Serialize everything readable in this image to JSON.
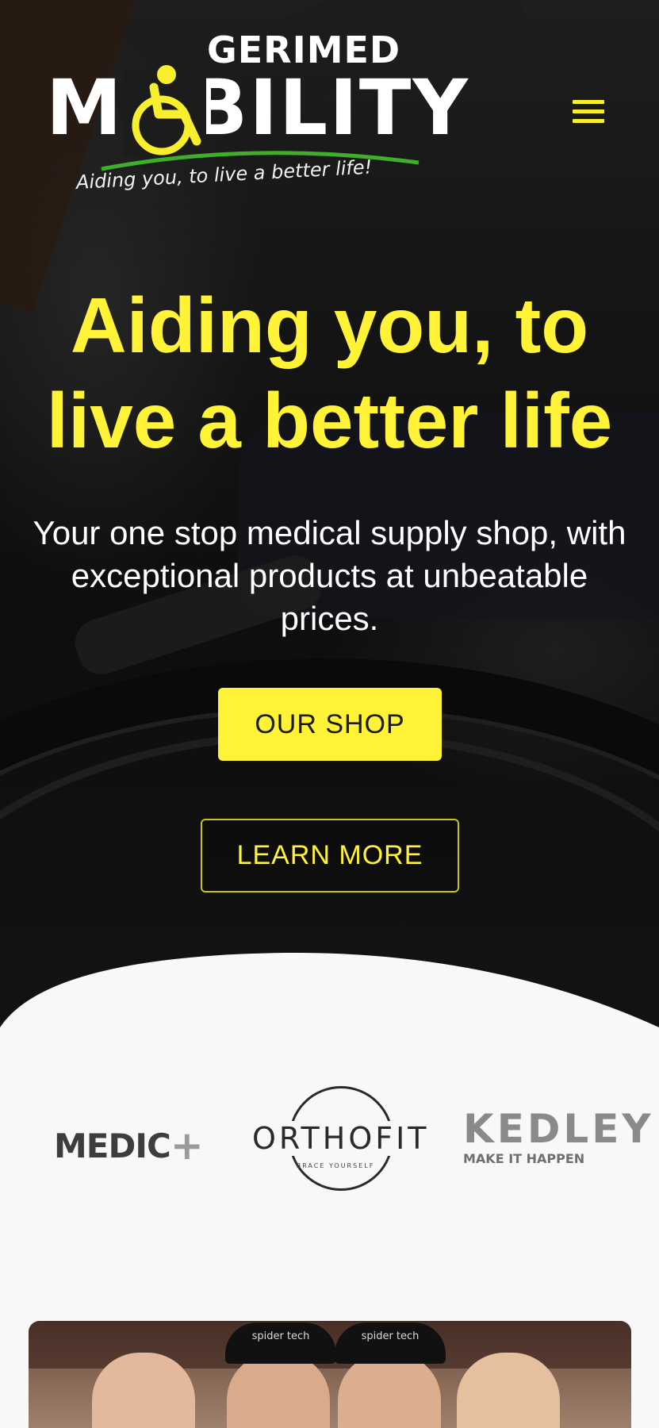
{
  "header": {
    "logo_top": "GERIMED",
    "logo_main": "MOBILITY",
    "logo_tagline": "Aiding you, to live a better life!",
    "menu_icon": "hamburger-menu-icon"
  },
  "hero": {
    "headline": "Aiding you, to live a better life",
    "subtext": "Your one stop medical supply shop, with exceptional products at unbeatable prices.",
    "shop_button": "OUR SHOP",
    "learn_button": "LEARN MORE"
  },
  "brands": {
    "medic": "MEDIC",
    "medic_plus": "+",
    "orthofit": "ORTHOFIT",
    "orthofit_tagline": "BRACE YOURSELF",
    "kedley": "KEDLEY",
    "kedley_tagline": "MAKE IT HAPPEN"
  },
  "photo": {
    "cap_left": "spider tech",
    "cap_right": "spider tech"
  },
  "colors": {
    "accent": "#fff237",
    "logo_green": "#3fae2a",
    "section_bg": "#f8f8f8"
  }
}
